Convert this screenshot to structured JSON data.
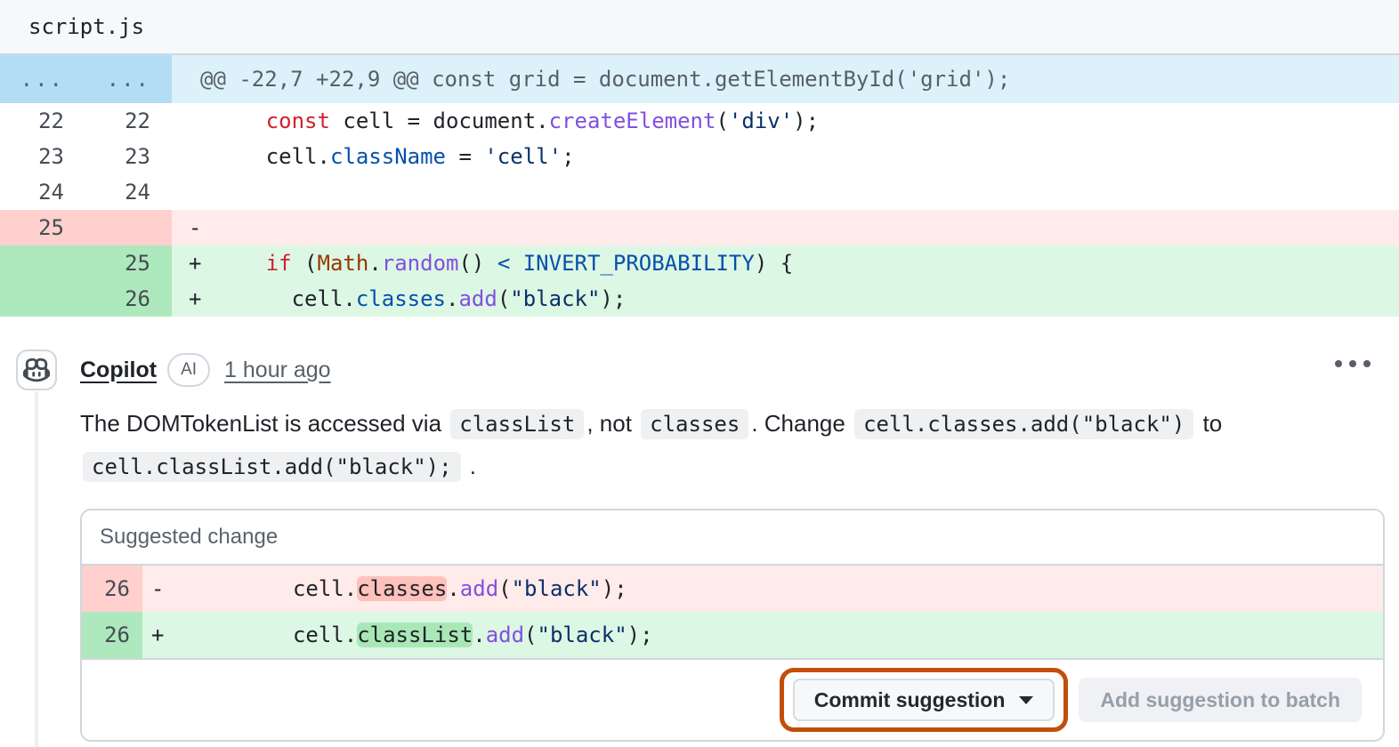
{
  "colors": {
    "keyword": "#cf222e",
    "function": "#8250df",
    "constant": "#0550ae",
    "string": "#0a3069",
    "entity": "#953800",
    "code_text": "#1f2328",
    "header_bg": "#f6f8fa",
    "border": "#d0d7de",
    "muted": "#59636e",
    "hunk_gutter_bg": "#b3ddf5",
    "hunk_bg": "#ddf1fa",
    "hunk_text": "#57606a",
    "del_gutter_bg": "#ffd0cd",
    "del_bg": "#ffebe9",
    "del_word_bg": "#ffc1bc",
    "add_gutter_bg": "#aee8bd",
    "add_bg": "#dcf7e3",
    "add_word_bg": "#a9e8b6",
    "inline_code_bg": "#eef0f2",
    "highlight_ring": "#c24e0a",
    "btn_bg": "#f6f8fa",
    "btn_text": "#24292f",
    "btn_disabled_bg": "#eff1f4",
    "btn_disabled_text": "#969fa8"
  },
  "file": {
    "name": "script.js"
  },
  "diff": {
    "hunk": {
      "expand_dots": "...",
      "text": "@@ -22,7 +22,9 @@ const grid = document.getElementById('grid');"
    },
    "rows": [
      {
        "type": "context",
        "old": "22",
        "new": "22",
        "segments": [
          {
            "t": "      ",
            "c": "pl"
          },
          {
            "t": "const",
            "c": "kw"
          },
          {
            "t": " cell = document.",
            "c": "pl"
          },
          {
            "t": "createElement",
            "c": "fn"
          },
          {
            "t": "(",
            "c": "pl"
          },
          {
            "t": "'div'",
            "c": "st"
          },
          {
            "t": ");",
            "c": "pl"
          }
        ]
      },
      {
        "type": "context",
        "old": "23",
        "new": "23",
        "segments": [
          {
            "t": "      cell.",
            "c": "pl"
          },
          {
            "t": "className",
            "c": "pr"
          },
          {
            "t": " = ",
            "c": "pl"
          },
          {
            "t": "'cell'",
            "c": "st"
          },
          {
            "t": ";",
            "c": "pl"
          }
        ]
      },
      {
        "type": "context",
        "old": "24",
        "new": "24",
        "segments": []
      },
      {
        "type": "del",
        "old": "25",
        "new": "",
        "segments": [
          {
            "t": "-",
            "c": "pl"
          }
        ]
      },
      {
        "type": "add",
        "old": "",
        "new": "25",
        "segments": [
          {
            "t": "+     ",
            "c": "pl"
          },
          {
            "t": "if",
            "c": "kw"
          },
          {
            "t": " (",
            "c": "pl"
          },
          {
            "t": "Math",
            "c": "en"
          },
          {
            "t": ".",
            "c": "pl"
          },
          {
            "t": "random",
            "c": "fn"
          },
          {
            "t": "() ",
            "c": "pl"
          },
          {
            "t": "<",
            "c": "pr"
          },
          {
            "t": " ",
            "c": "pl"
          },
          {
            "t": "INVERT_PROBABILITY",
            "c": "pr"
          },
          {
            "t": ") {",
            "c": "pl"
          }
        ]
      },
      {
        "type": "add",
        "old": "",
        "new": "26",
        "segments": [
          {
            "t": "+       cell.",
            "c": "pl"
          },
          {
            "t": "classes",
            "c": "pr"
          },
          {
            "t": ".",
            "c": "pl"
          },
          {
            "t": "add",
            "c": "fn"
          },
          {
            "t": "(",
            "c": "pl"
          },
          {
            "t": "\"black\"",
            "c": "st"
          },
          {
            "t": ");",
            "c": "pl"
          }
        ]
      }
    ]
  },
  "comment": {
    "author": "Copilot",
    "badge": "AI",
    "timestamp": "1 hour ago",
    "menu_icon": "kebab-horizontal-icon",
    "avatar_icon": "copilot-icon",
    "body_lines": [
      [
        {
          "t": "The DOMTokenList is accessed via "
        },
        {
          "t": "classList",
          "code": true
        },
        {
          "t": ", not "
        },
        {
          "t": "classes",
          "code": true
        },
        {
          "t": ". Change "
        },
        {
          "t": "cell.classes.add(\"black\")",
          "code": true
        },
        {
          "t": " to"
        }
      ],
      [
        {
          "t": "cell.classList.add(\"black\");",
          "code": true
        },
        {
          "t": " ."
        }
      ]
    ]
  },
  "suggestion": {
    "title": "Suggested change",
    "rows": [
      {
        "type": "del",
        "num": "26",
        "segments": [
          {
            "t": "-          cell.",
            "c": "pl"
          },
          {
            "t": "classes",
            "c": "pl",
            "h": "d"
          },
          {
            "t": ".",
            "c": "pl"
          },
          {
            "t": "add",
            "c": "fn"
          },
          {
            "t": "(",
            "c": "pl"
          },
          {
            "t": "\"black\"",
            "c": "st"
          },
          {
            "t": ");",
            "c": "pl"
          }
        ]
      },
      {
        "type": "add",
        "num": "26",
        "segments": [
          {
            "t": "+          cell.",
            "c": "pl"
          },
          {
            "t": "classList",
            "c": "pl",
            "h": "a"
          },
          {
            "t": ".",
            "c": "pl"
          },
          {
            "t": "add",
            "c": "fn"
          },
          {
            "t": "(",
            "c": "pl"
          },
          {
            "t": "\"black\"",
            "c": "st"
          },
          {
            "t": ");",
            "c": "pl"
          }
        ]
      }
    ],
    "commit_label": "Commit suggestion",
    "batch_label": "Add suggestion to batch"
  }
}
